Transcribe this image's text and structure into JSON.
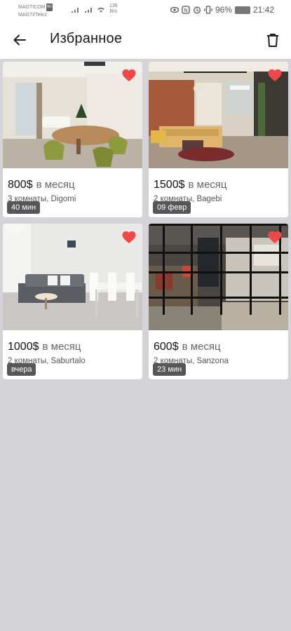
{
  "status_bar": {
    "carrier1": "MAGTICOM",
    "carrier1_tag": "HD",
    "carrier2": "MAGTI/Tele2",
    "speed_value": "136",
    "speed_unit": "B/s",
    "battery": "96%",
    "time": "21:42"
  },
  "app_bar": {
    "title": "Избранное",
    "back_icon": "arrow-left-icon",
    "delete_icon": "trash-icon"
  },
  "colors": {
    "heart": "#f04848",
    "badge": "#2b2b2b",
    "background": "#d4d4d8"
  },
  "listings": [
    {
      "time": "40 мин",
      "price": "800$",
      "period": "в месяц",
      "description": "3 комнаты, Digomi",
      "favorite": true
    },
    {
      "time": "09 февр",
      "price": "1500$",
      "period": "в месяц",
      "description": "2 комнаты, Bagebi",
      "favorite": true
    },
    {
      "time": "вчера",
      "price": "1000$",
      "period": "в месяц",
      "description": "2 комнаты, Saburtalo",
      "favorite": true
    },
    {
      "time": "23 мин",
      "price": "600$",
      "period": "в месяц",
      "description": "2 комнаты, Sanzona",
      "favorite": true
    }
  ]
}
